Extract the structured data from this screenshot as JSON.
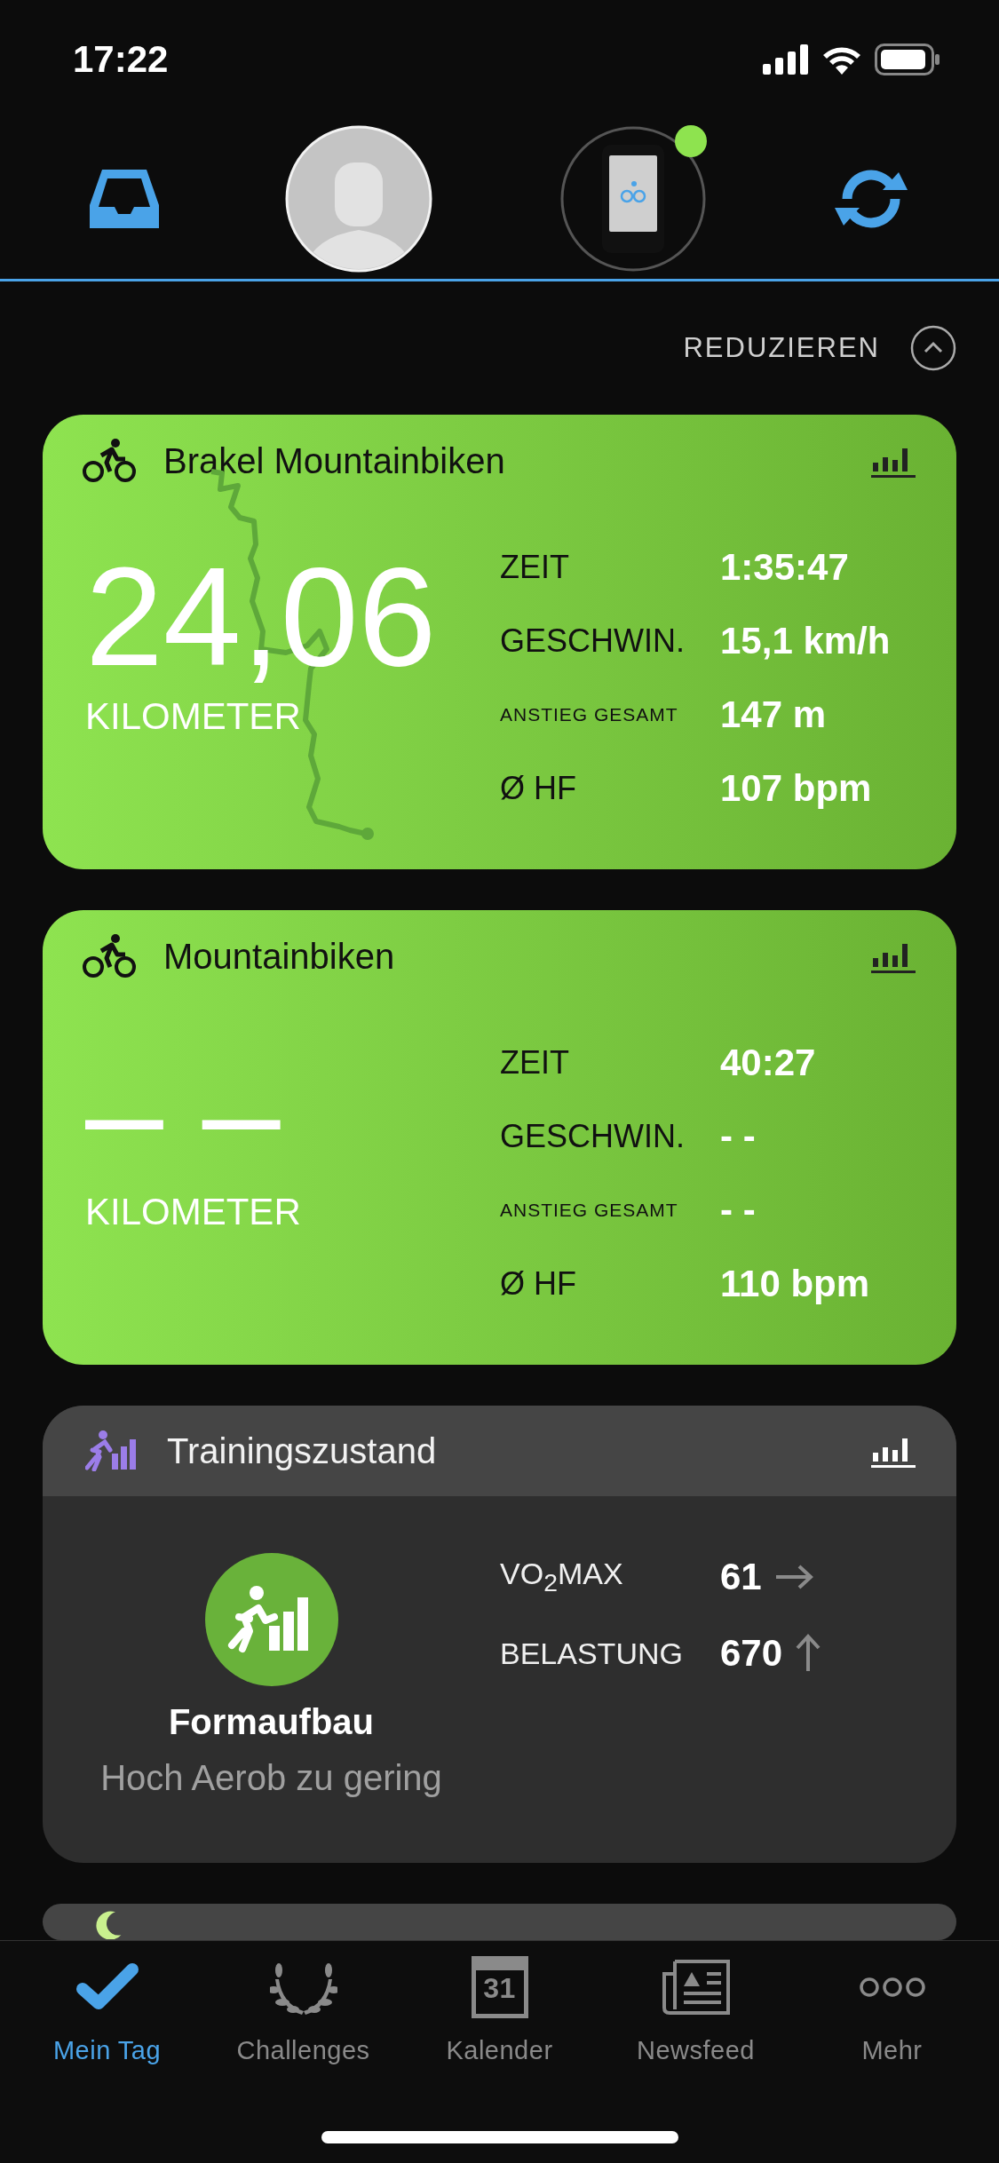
{
  "status_bar": {
    "time": "17:22"
  },
  "device": {
    "connected": true
  },
  "collapse_button": {
    "label": "REDUZIEREN"
  },
  "activity_cards": [
    {
      "title": "Brakel Mountainbiken",
      "distance": "24,06",
      "distance_unit": "KILOMETER",
      "route_map": true,
      "stats": [
        {
          "label": "ZEIT",
          "value": "1:35:47",
          "compact": false
        },
        {
          "label": "GESCHWIN.",
          "value": "15,1 km/h",
          "compact": false
        },
        {
          "label": "ANSTIEG GESAMT",
          "value": "147 m",
          "compact": true
        },
        {
          "label": "Ø HF",
          "value": "107 bpm",
          "compact": false
        }
      ]
    },
    {
      "title": "Mountainbiken",
      "distance": "– –",
      "distance_unit": "KILOMETER",
      "route_map": false,
      "stats": [
        {
          "label": "ZEIT",
          "value": "40:27",
          "compact": false
        },
        {
          "label": "GESCHWIN.",
          "value": "- -",
          "compact": false
        },
        {
          "label": "ANSTIEG GESAMT",
          "value": "- -",
          "compact": true
        },
        {
          "label": "Ø HF",
          "value": "110 bpm",
          "compact": false
        }
      ]
    }
  ],
  "training_card": {
    "title": "Trainingszustand",
    "status": "Formaufbau",
    "detail": "Hoch Aerob zu gering",
    "stats": [
      {
        "label": "VO$_{2}$MAX",
        "value": "61",
        "kind": "steady"
      },
      {
        "label": "BELASTUNG",
        "value": "670",
        "kind": "rising"
      }
    ]
  },
  "tabs": [
    {
      "label": "Mein Tag",
      "kind": "check",
      "selected": true
    },
    {
      "label": "Challenges",
      "kind": "laurel",
      "selected": false
    },
    {
      "label": "Kalender",
      "kind": "calendar",
      "badge": "31",
      "selected": false
    },
    {
      "label": "Newsfeed",
      "kind": "news",
      "selected": false
    },
    {
      "label": "Mehr",
      "kind": "more",
      "selected": false
    }
  ]
}
